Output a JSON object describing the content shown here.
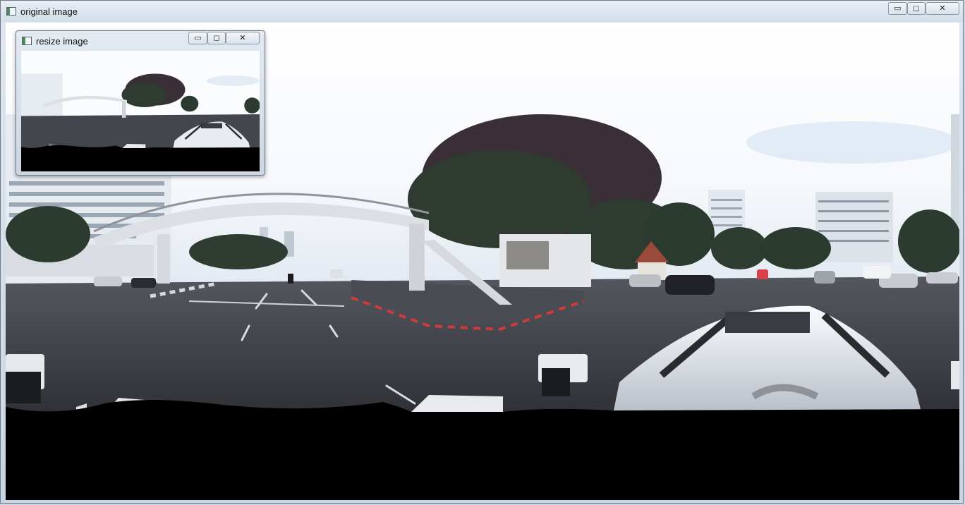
{
  "main_window": {
    "title": "original image",
    "controls": {
      "minimize": "▭",
      "restore": "◻",
      "close": "✕"
    },
    "image_description_icon": "app-icon"
  },
  "child_window": {
    "title": "resize image",
    "controls": {
      "minimize": "▭",
      "restore": "◻",
      "close": "✕"
    }
  },
  "colors": {
    "sky": "#ffffff",
    "road": "#3b3d44",
    "tree": "#2e3a30",
    "building": "#e9eef3",
    "black_mask": "#000000"
  }
}
